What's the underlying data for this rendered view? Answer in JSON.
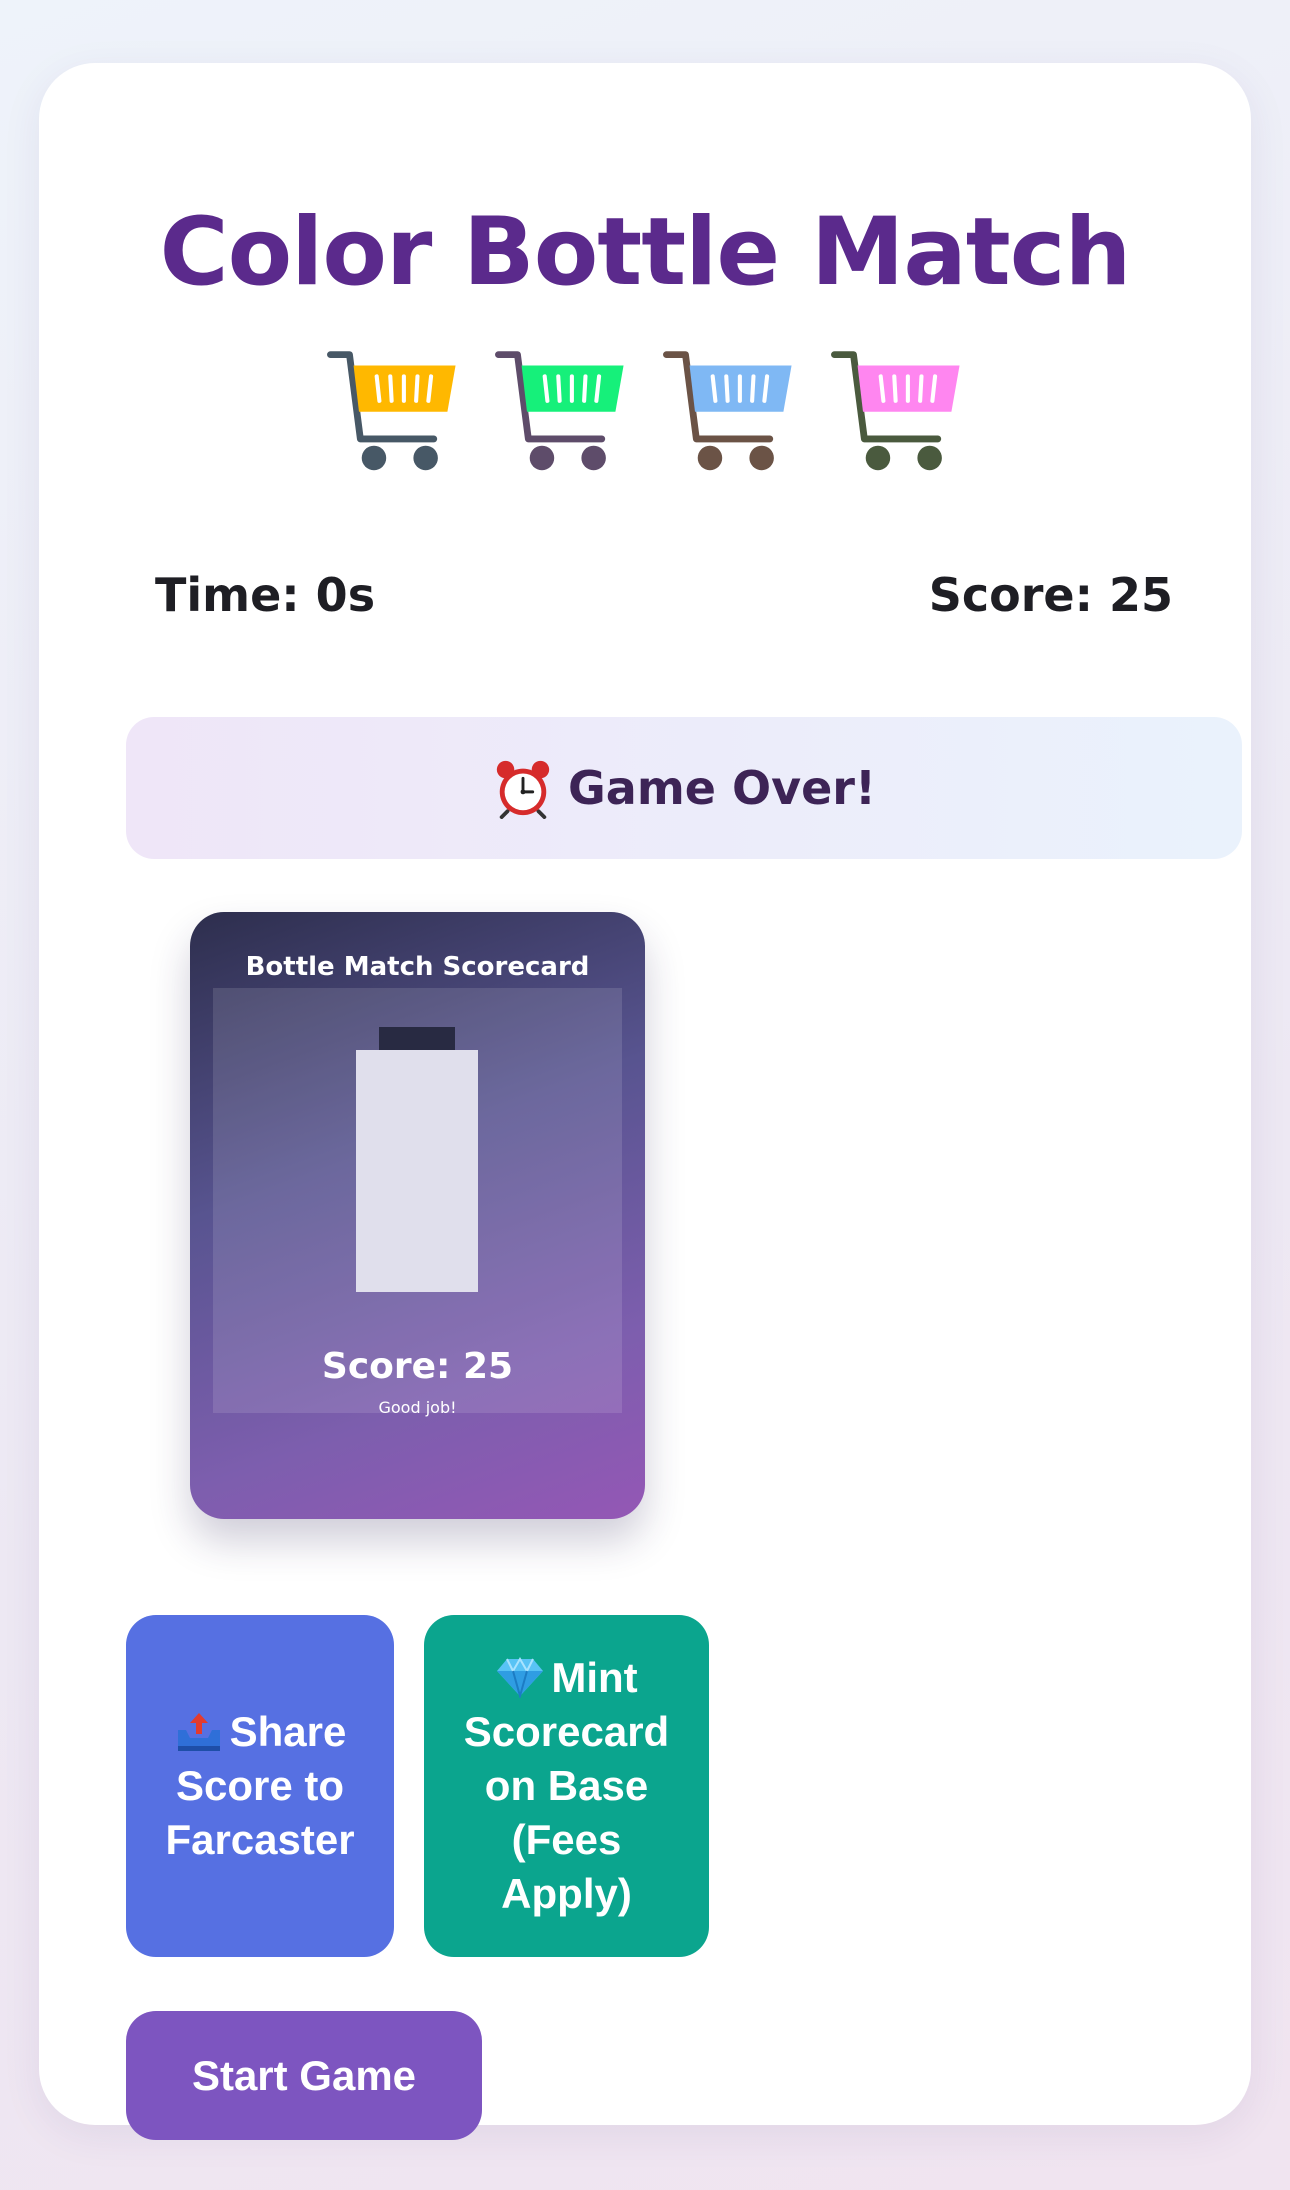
{
  "app": {
    "title": "Color Bottle Match"
  },
  "carts": [
    {
      "icon": "shopping-cart-icon",
      "basket_color": "#ffb800",
      "wheel_color": "#475866"
    },
    {
      "icon": "shopping-cart-icon",
      "basket_color": "#16f07a",
      "wheel_color": "#5e4c6a"
    },
    {
      "icon": "shopping-cart-icon",
      "basket_color": "#7fb8f4",
      "wheel_color": "#6b5346"
    },
    {
      "icon": "shopping-cart-icon",
      "basket_color": "#ff86f0",
      "wheel_color": "#4a5a3e"
    }
  ],
  "stats": {
    "time": "Time: 0s",
    "score": "Score: 25"
  },
  "banner": {
    "icon": "alarm-clock-icon",
    "text": "Game Over!"
  },
  "scorecard": {
    "title": "Bottle Match Scorecard",
    "score": "Score: 25",
    "message": "Good job!"
  },
  "actions": {
    "share": {
      "icon": "outbox-tray-icon",
      "label": "Share Score to Farcaster"
    },
    "mint": {
      "icon": "gem-icon",
      "label": "Mint Scorecard on Base (Fees Apply)"
    },
    "start": {
      "label": "Start Game"
    }
  },
  "colors": {
    "title": "#5b2a8c",
    "share_button": "#5670e2",
    "mint_button": "#0ba58e",
    "start_button": "#7d55c0"
  }
}
